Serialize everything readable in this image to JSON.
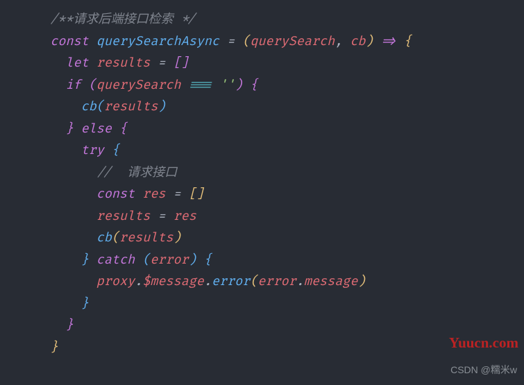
{
  "code": {
    "l1_comment": "/**请求后端接口检索 */",
    "l2_const": "const",
    "l2_fn": "querySearchAsync",
    "l2_eq": " = ",
    "l2_op_paren": "(",
    "l2_p1": "querySearch",
    "l2_comma": ", ",
    "l2_p2": "cb",
    "l2_cl_paren": ")",
    "l2_arrow": " => ",
    "l2_brace": "{",
    "l3_let": "let",
    "l3_var": "results",
    "l3_eq": " = ",
    "l3_br_o": "[",
    "l3_br_c": "]",
    "l4_if": "if",
    "l4_po": "(",
    "l4_var": "querySearch",
    "l4_op": " === ",
    "l4_str": "''",
    "l4_pc": ")",
    "l4_brace": "{",
    "l5_fn": "cb",
    "l5_po": "(",
    "l5_arg": "results",
    "l5_pc": ")",
    "l6_brace_c": "}",
    "l6_else": "else",
    "l6_brace_o": "{",
    "l7_try": "try",
    "l7_brace": "{",
    "l8_comment": "//  请求接口",
    "l9_const": "const",
    "l9_var": "res",
    "l9_eq": " = ",
    "l9_br_o": "[",
    "l9_br_c": "]",
    "l10_var1": "results",
    "l10_eq": " = ",
    "l10_var2": "res",
    "l11_fn": "cb",
    "l11_po": "(",
    "l11_arg": "results",
    "l11_pc": ")",
    "l12_brace_c": "}",
    "l12_catch": "catch",
    "l12_po": "(",
    "l12_err": "error",
    "l12_pc": ")",
    "l12_brace_o": "{",
    "l13_obj": "proxy",
    "l13_dot1": ".",
    "l13_prop": "$message",
    "l13_dot2": ".",
    "l13_method": "error",
    "l13_po": "(",
    "l13_arg1": "error",
    "l13_dot3": ".",
    "l13_arg2": "message",
    "l13_pc": ")",
    "l14_brace": "}",
    "l15_brace": "}",
    "l16_brace": "}"
  },
  "watermarks": {
    "red": "Yuucn.com",
    "gray": "CSDN @糯米w"
  }
}
